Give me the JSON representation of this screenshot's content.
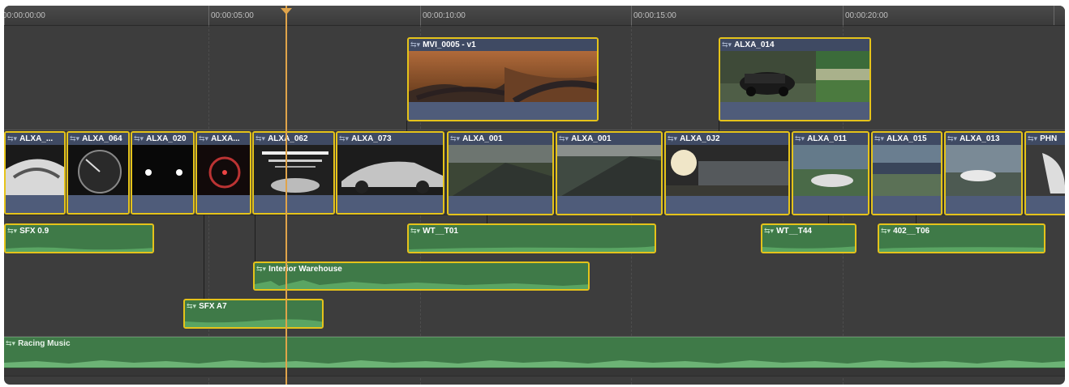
{
  "ruler": {
    "ticks": [
      "00:00:00:00",
      "00:00:05:00",
      "00:00:10:00",
      "00:00:15:00",
      "00:00:20:00"
    ]
  },
  "connected_video": [
    {
      "name": "MVI_0005 - v1"
    },
    {
      "name": "ALXA_014"
    }
  ],
  "primary_storyline": [
    {
      "name": "ALXA_..."
    },
    {
      "name": "ALXA_064"
    },
    {
      "name": "ALXA_020"
    },
    {
      "name": "ALXA..."
    },
    {
      "name": "ALXA_062"
    },
    {
      "name": "ALXA_073"
    },
    {
      "name": "ALXA_001"
    },
    {
      "name": "ALXA_001"
    },
    {
      "name": "ALXA_0J2"
    },
    {
      "name": "ALXA_011"
    },
    {
      "name": "ALXA_015"
    },
    {
      "name": "ALXA_013"
    },
    {
      "name": "PHN"
    }
  ],
  "audio_clips": [
    {
      "name": "SFX 0.9"
    },
    {
      "name": "WT__T01"
    },
    {
      "name": "WT__T44"
    },
    {
      "name": "402__T06"
    },
    {
      "name": "Interior Warehouse"
    },
    {
      "name": "SFX A7"
    }
  ],
  "music_track": {
    "name": "Racing Music"
  },
  "colors": {
    "selection": "#e5c31a",
    "playhead": "#e0a44a",
    "video_clip": "#4f5c7a",
    "audio_clip": "#3f7a48",
    "background": "#3d3d3d"
  },
  "icons": {
    "clip_menu": "clip-menu-icon",
    "playhead": "playhead-icon"
  }
}
